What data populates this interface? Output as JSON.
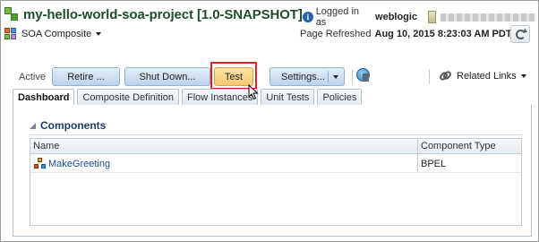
{
  "header": {
    "title": "my-hello-world-soa-project [1.0-SNAPSHOT]",
    "login_label": "Logged in as",
    "login_user": "weblogic",
    "info_icon": "i",
    "composite_icon": "composite-icon",
    "server_icon": "server-icon",
    "server_name_blurred": "server-name (blurred)"
  },
  "subheader": {
    "menu_label": "SOA Composite",
    "refresh_label": "Page Refreshed",
    "refresh_time": "Aug 10, 2015 8:23:03 AM PDT"
  },
  "toolbar": {
    "status_label": "Active",
    "retire_label": "Retire ...",
    "shutdown_label": "Shut Down...",
    "test_label": "Test",
    "settings_label": "Settings...",
    "related_links_label": "Related Links",
    "highlight_color": "#e02020"
  },
  "tabs": [
    {
      "label": "Dashboard",
      "active": true
    },
    {
      "label": "Composite Definition",
      "active": false
    },
    {
      "label": "Flow Instances",
      "active": false
    },
    {
      "label": "Unit Tests",
      "active": false
    },
    {
      "label": "Policies",
      "active": false
    }
  ],
  "components": {
    "title": "Components",
    "columns": [
      "Name",
      "Component Type"
    ],
    "rows": [
      {
        "name": "MakeGreeting",
        "type": "BPEL"
      }
    ]
  },
  "colors": {
    "title": "#1f4e2a",
    "link": "#1b4f9c",
    "button_bg": "#bcd3ea",
    "test_button_bg": "#f7c872"
  }
}
